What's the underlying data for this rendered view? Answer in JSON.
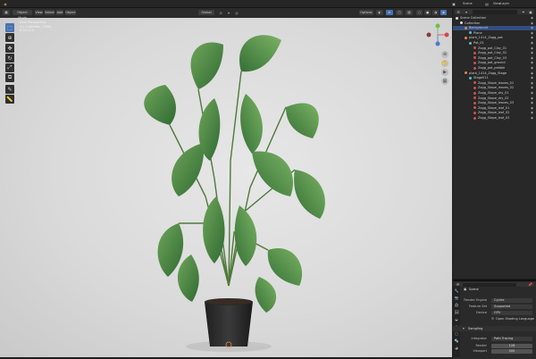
{
  "topbar": {
    "scene_label": "Scene",
    "view_layer_label": "ViewLayer"
  },
  "viewport_header": {
    "mode": "Object Mode",
    "menus": [
      "View",
      "Select",
      "Add",
      "Object"
    ],
    "orientation": "Global",
    "options_label": "Options"
  },
  "viewport": {
    "overlay_lines": [
      "User Perspective",
      "(1) Collection | Plant",
      "8.04 Ciril"
    ]
  },
  "tools": [
    "select-box",
    "cursor",
    "move",
    "rotate",
    "scale",
    "transform",
    "annotate",
    "measure"
  ],
  "navigation": [
    "zoom",
    "pan",
    "camera",
    "perspective"
  ],
  "outliner": {
    "search_placeholder": "",
    "items": [
      {
        "label": "Scene Collection",
        "level": 0,
        "icon": "collection-icon",
        "selected": false
      },
      {
        "label": "Collection",
        "level": 1,
        "icon": "collection-icon",
        "selected": false
      },
      {
        "label": "Background",
        "level": 2,
        "icon": "object-icon",
        "selected": true
      },
      {
        "label": "Plane",
        "level": 3,
        "icon": "mesh-icon",
        "selected": false
      },
      {
        "label": "plant_1414_Zogg_pot",
        "level": 2,
        "icon": "object-icon",
        "selected": false
      },
      {
        "label": "Pot_01",
        "level": 3,
        "icon": "mesh-icon",
        "selected": false
      },
      {
        "label": "Zogg_pot_Clay_01",
        "level": 4,
        "icon": "material-icon",
        "selected": false
      },
      {
        "label": "Zogg_pot_Clay_02",
        "level": 4,
        "icon": "material-icon",
        "selected": false
      },
      {
        "label": "Zogg_pot_Clay_03",
        "level": 4,
        "icon": "material-icon",
        "selected": false
      },
      {
        "label": "Zogg_pot_ground",
        "level": 4,
        "icon": "material-icon",
        "selected": false
      },
      {
        "label": "Zogg_pot_pebble",
        "level": 4,
        "icon": "material-icon",
        "selected": false
      },
      {
        "label": "plant_1414_Zogg_Stage",
        "level": 2,
        "icon": "object-icon",
        "selected": false
      },
      {
        "label": "Stage011",
        "level": 3,
        "icon": "mesh-icon",
        "selected": false
      },
      {
        "label": "Zogg_Stape_leaves_01",
        "level": 4,
        "icon": "material-icon",
        "selected": false
      },
      {
        "label": "Zogg_Stape_leaves_02",
        "level": 4,
        "icon": "material-icon",
        "selected": false
      },
      {
        "label": "Zogg_Stape_dry_01",
        "level": 4,
        "icon": "material-icon",
        "selected": false
      },
      {
        "label": "Zogg_Stape_dry_02",
        "level": 4,
        "icon": "material-icon",
        "selected": false
      },
      {
        "label": "Zogg_Stape_leaves_03",
        "level": 4,
        "icon": "material-icon",
        "selected": false
      },
      {
        "label": "Zogg_Stape_leaf_01",
        "level": 4,
        "icon": "material-icon",
        "selected": false
      },
      {
        "label": "Zogg_Stape_leaf_02",
        "level": 4,
        "icon": "material-icon",
        "selected": false
      },
      {
        "label": "Zogg_Stape_leaf_03",
        "level": 4,
        "icon": "material-icon",
        "selected": false
      }
    ]
  },
  "properties": {
    "panel_title": "Scene",
    "render_engine_label": "Render Engine",
    "render_engine_value": "Cycles",
    "feature_set_label": "Feature Set",
    "feature_set_value": "Supported",
    "device_label": "Device",
    "device_value": "GPU",
    "osl_label": "Open Shading Language",
    "sampling_label": "Sampling",
    "integrator_label": "Integrator",
    "integrator_value": "Path Tracing",
    "render_label": "Render",
    "render_value": "128",
    "viewport_label": "Viewport",
    "viewport_value": "500"
  },
  "colors": {
    "accent": "#4772b3",
    "selection": "#334d80",
    "object_orange": "#e08a3a",
    "material_red": "#d05050",
    "mesh_cyan": "#55c0d0"
  }
}
